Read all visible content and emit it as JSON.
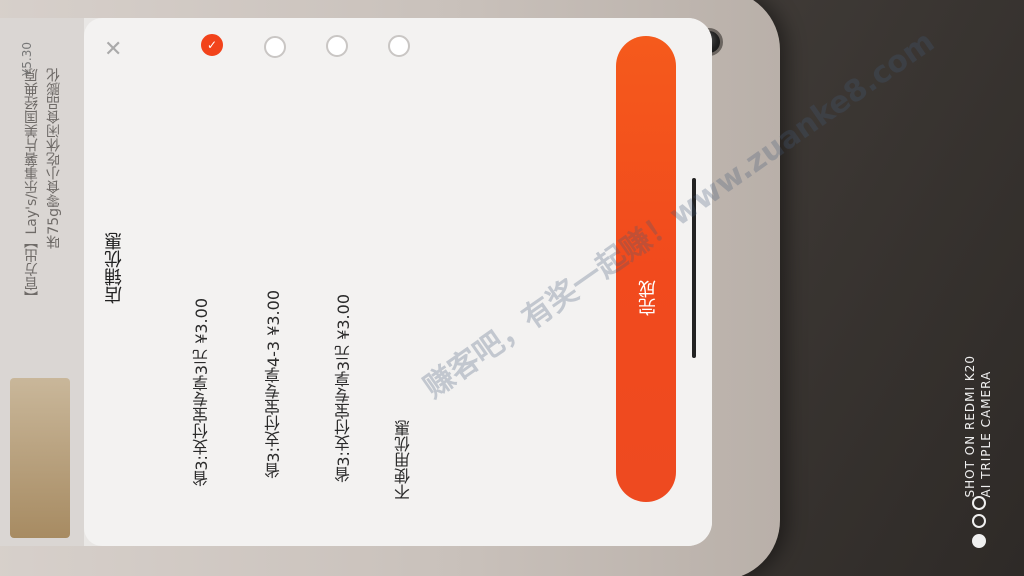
{
  "sheet": {
    "title": "店铺优惠",
    "done_label": "完成",
    "options": [
      {
        "label": "省3:支付宝专享3元  ¥3.00",
        "selected": true
      },
      {
        "label": "省3:支付宝专享4-3  ¥3.00",
        "selected": false
      },
      {
        "label": "省3:支付宝专享3元  ¥3.00",
        "selected": false
      },
      {
        "label": "不使用优惠",
        "selected": false
      }
    ]
  },
  "background_page": {
    "line1": "【官方出】Lay's/乐事薯片美国经典原",
    "line2": "味75g零食小吃休闲食品膨化",
    "price": "¥5.30"
  },
  "watermark": "赚客吧，有奖一起赚！www.zuanke8.com",
  "camera_stamp": {
    "line1": "SHOT ON REDMI K20",
    "line2": "AI TRIPLE CAMERA"
  },
  "colors": {
    "accent": "#f2431b",
    "button": "#f14a1d"
  }
}
